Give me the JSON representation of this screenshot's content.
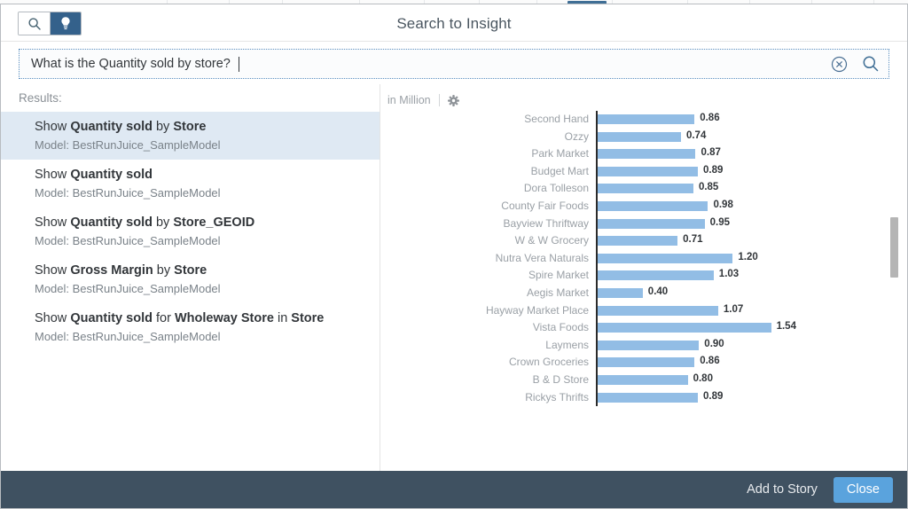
{
  "header": {
    "title": "Search to Insight",
    "toggle": [
      {
        "name": "search-mode",
        "icon": "search-icon",
        "active": false
      },
      {
        "name": "insight-mode",
        "icon": "lightbulb-icon",
        "active": true
      }
    ]
  },
  "search": {
    "value": "What is the Quantity sold by store?",
    "placeholder": "",
    "clear_icon": "clear-circle-icon",
    "submit_icon": "search-icon"
  },
  "results": {
    "label": "Results:",
    "model_prefix": "Model: ",
    "items": [
      {
        "parts": [
          {
            "t": "Show ",
            "b": false
          },
          {
            "t": "Quantity sold",
            "b": true
          },
          {
            "t": " by ",
            "b": false
          },
          {
            "t": "Store",
            "b": true
          }
        ],
        "model": "Model: BestRunJuice_SampleModel",
        "selected": true
      },
      {
        "parts": [
          {
            "t": "Show ",
            "b": false
          },
          {
            "t": "Quantity sold",
            "b": true
          }
        ],
        "model": "Model: BestRunJuice_SampleModel",
        "selected": false
      },
      {
        "parts": [
          {
            "t": "Show ",
            "b": false
          },
          {
            "t": "Quantity sold",
            "b": true
          },
          {
            "t": " by ",
            "b": false
          },
          {
            "t": "Store_GEOID",
            "b": true
          }
        ],
        "model": "Model: BestRunJuice_SampleModel",
        "selected": false
      },
      {
        "parts": [
          {
            "t": "Show ",
            "b": false
          },
          {
            "t": "Gross Margin",
            "b": true
          },
          {
            "t": " by ",
            "b": false
          },
          {
            "t": "Store",
            "b": true
          }
        ],
        "model": "Model: BestRunJuice_SampleModel",
        "selected": false
      },
      {
        "parts": [
          {
            "t": "Show ",
            "b": false
          },
          {
            "t": "Quantity sold",
            "b": true
          },
          {
            "t": " for ",
            "b": false
          },
          {
            "t": "Wholeway Store",
            "b": true
          },
          {
            "t": " in ",
            "b": false
          },
          {
            "t": "Store",
            "b": true
          }
        ],
        "model": "Model: BestRunJuice_SampleModel",
        "selected": false
      }
    ]
  },
  "chart_header": {
    "unit": "in Million",
    "settings_icon": "gear-icon"
  },
  "chart_data": {
    "type": "bar",
    "orientation": "horizontal",
    "title": "",
    "xlabel": "",
    "ylabel": "",
    "unit": "in Million",
    "grid": false,
    "legend": "none",
    "xlim": [
      0,
      1.7
    ],
    "categories": [
      "Second Hand",
      "Ozzy",
      "Park Market",
      "Budget Mart",
      "Dora Tolleson",
      "County Fair Foods",
      "Bayview Thriftway",
      "W & W Grocery",
      "Nutra Vera Naturals",
      "Spire Market",
      "Aegis Market",
      "Hayway Market Place",
      "Vista Foods",
      "Laymens",
      "Crown Groceries",
      "B & D Store",
      "Rickys Thrifts"
    ],
    "values": [
      0.86,
      0.74,
      0.87,
      0.89,
      0.85,
      0.98,
      0.95,
      0.71,
      1.2,
      1.03,
      0.4,
      1.07,
      1.54,
      0.9,
      0.86,
      0.8,
      0.89
    ],
    "labels": [
      "0.86",
      "0.74",
      "0.87",
      "0.89",
      "0.85",
      "0.98",
      "0.95",
      "0.71",
      "1.20",
      "1.03",
      "0.40",
      "1.07",
      "1.54",
      "0.90",
      "0.86",
      "0.80",
      "0.89"
    ],
    "series": [
      {
        "name": "Quantity sold",
        "values": [
          0.86,
          0.74,
          0.87,
          0.89,
          0.85,
          0.98,
          0.95,
          0.71,
          1.2,
          1.03,
          0.4,
          1.07,
          1.54,
          0.9,
          0.86,
          0.8,
          0.89
        ]
      }
    ],
    "bar_color": "#92bde5"
  },
  "footer": {
    "add_to_story": "Add to Story",
    "close": "Close",
    "close_color": "#5aa3dd",
    "bar_color": "#3f5161"
  }
}
